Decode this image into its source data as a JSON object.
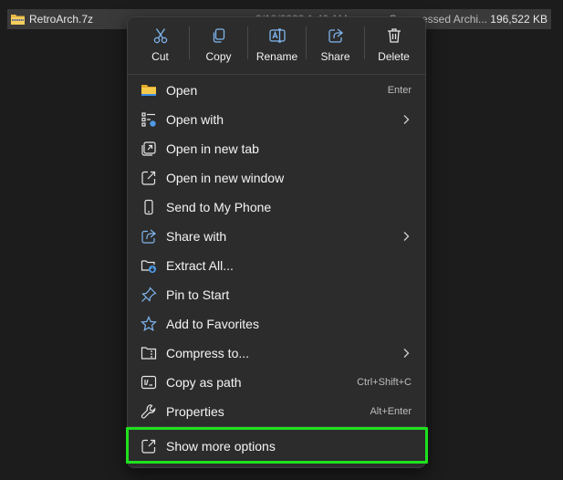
{
  "file_row": {
    "name": "RetroArch.7z",
    "date": "2/18/2023 1:40 AM",
    "type": "Compressed Archi...",
    "size": "196,522 KB"
  },
  "quick_actions": [
    {
      "label": "Cut",
      "icon": "scissors-icon"
    },
    {
      "label": "Copy",
      "icon": "copy-icon"
    },
    {
      "label": "Rename",
      "icon": "rename-icon"
    },
    {
      "label": "Share",
      "icon": "share-icon"
    },
    {
      "label": "Delete",
      "icon": "trash-icon"
    }
  ],
  "items": [
    {
      "label": "Open",
      "shortcut": "Enter",
      "icon": "folder-icon"
    },
    {
      "label": "Open with",
      "shortcut": "",
      "icon": "apps-icon",
      "submenu": true
    },
    {
      "label": "Open in new tab",
      "shortcut": "",
      "icon": "new-tab-icon"
    },
    {
      "label": "Open in new window",
      "shortcut": "",
      "icon": "new-window-icon"
    },
    {
      "label": "Send to My Phone",
      "shortcut": "",
      "icon": "phone-icon"
    },
    {
      "label": "Share with",
      "shortcut": "",
      "icon": "share-with-icon",
      "submenu": true
    },
    {
      "label": "Extract All...",
      "shortcut": "",
      "icon": "extract-icon"
    },
    {
      "label": "Pin to Start",
      "shortcut": "",
      "icon": "pin-icon"
    },
    {
      "label": "Add to Favorites",
      "shortcut": "",
      "icon": "star-icon"
    },
    {
      "label": "Compress to...",
      "shortcut": "",
      "icon": "compress-icon",
      "submenu": true
    },
    {
      "label": "Copy as path",
      "shortcut": "Ctrl+Shift+C",
      "icon": "path-icon"
    },
    {
      "label": "Properties",
      "shortcut": "Alt+Enter",
      "icon": "wrench-icon"
    }
  ],
  "more_options": {
    "label": "Show more options",
    "icon": "expand-icon"
  },
  "colors": {
    "menu_bg": "#2c2c2c",
    "highlight": "#1fe01f",
    "accent_blue": "#63a9ee",
    "folder_yellow": "#f3c13a"
  }
}
